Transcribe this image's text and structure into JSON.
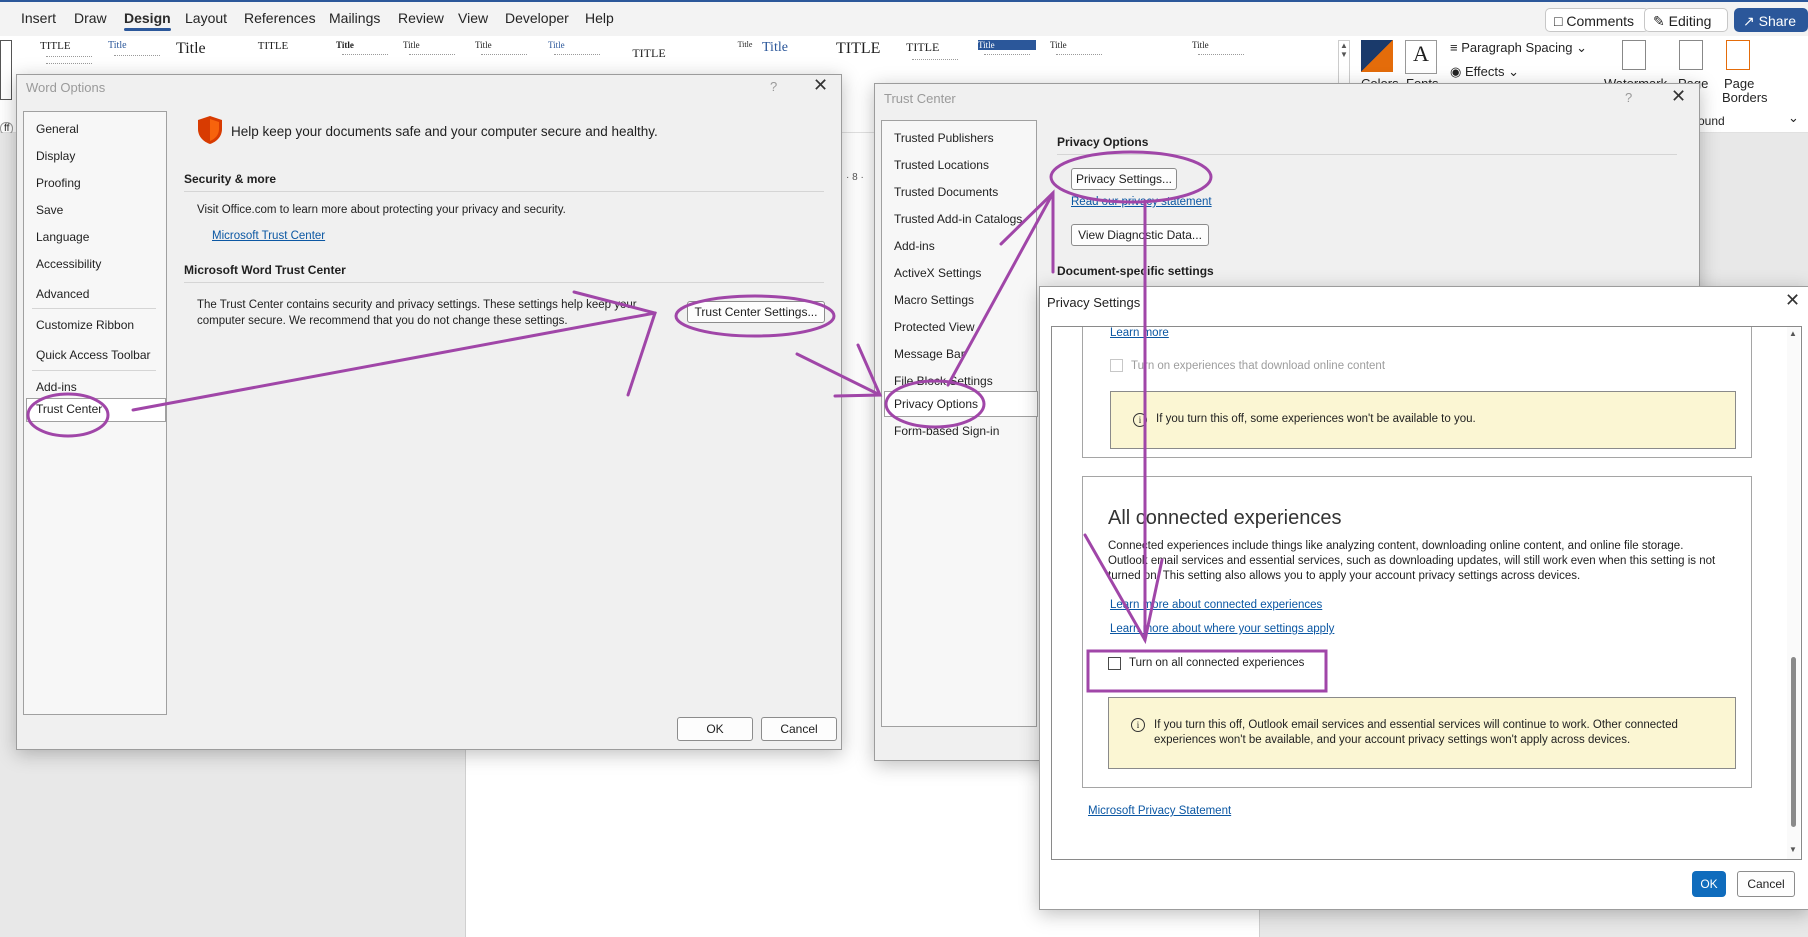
{
  "ribbon": {
    "tabs": [
      "Insert",
      "Draw",
      "Design",
      "Layout",
      "References",
      "Mailings",
      "Review",
      "View",
      "Developer",
      "Help"
    ],
    "active_tab": "Design",
    "comments": "Comments",
    "editing": "Editing",
    "share": "Share",
    "paragraph_spacing": "Paragraph Spacing",
    "effects": "Effects",
    "colors": "Colors",
    "fonts": "Fonts",
    "watermark": "Watermark",
    "page_color": "Page",
    "page_borders_1": "Page",
    "page_borders_2": "Borders",
    "page_background": "ound",
    "style_titles": [
      "TITLE",
      "Title",
      "Title",
      "TITLE",
      "Title",
      "Title",
      "Title",
      "Title",
      "TITLE",
      "Title",
      "Title",
      "TITLE",
      "TITLE",
      "Title",
      "Title",
      "Title"
    ],
    "ruler_mark": "· 8 ·",
    "left_fragment": "ff"
  },
  "word_options": {
    "title": "Word Options",
    "help": "?",
    "nav": [
      "General",
      "Display",
      "Proofing",
      "Save",
      "Language",
      "Accessibility",
      "Advanced",
      "Customize Ribbon",
      "Quick Access Toolbar",
      "Add-ins",
      "Trust Center"
    ],
    "selected": "Trust Center",
    "header": "Help keep your documents safe and your computer secure and healthy.",
    "security_heading": "Security & more",
    "security_text": "Visit Office.com to learn more about protecting your privacy and security.",
    "trust_link": "Microsoft Trust Center",
    "trust_heading": "Microsoft Word Trust Center",
    "trust_text_1": "The Trust Center contains security and privacy settings. These settings help keep your",
    "trust_text_2": "computer secure. We recommend that you do not change these settings.",
    "trust_button": "Trust Center Settings...",
    "ok": "OK",
    "cancel": "Cancel"
  },
  "trust_center": {
    "title": "Trust Center",
    "help": "?",
    "nav": [
      "Trusted Publishers",
      "Trusted Locations",
      "Trusted Documents",
      "Trusted Add-in Catalogs",
      "Add-ins",
      "ActiveX Settings",
      "Macro Settings",
      "Protected View",
      "Message Bar",
      "File Block Settings",
      "Privacy Options",
      "Form-based Sign-in"
    ],
    "selected": "Privacy Options",
    "privacy_heading": "Privacy Options",
    "privacy_button": "Privacy Settings...",
    "privacy_link": "Read our privacy statement",
    "diag_button": "View Diagnostic Data...",
    "doc_heading": "Document-specific settings"
  },
  "privacy_settings": {
    "title": "Privacy Settings",
    "learn_more": "Learn more",
    "download_label": "Turn on experiences that download online content",
    "info1": "If you turn this off, some experiences won't be available to you.",
    "section_title": "All connected experiences",
    "desc_1": "Connected experiences include things like analyzing content, downloading online content, and online file storage.",
    "desc_2": "Outlook email services and essential services, such as downloading updates, will still work even when this setting is not",
    "desc_3": "turned on. This setting also allows you to apply your account privacy settings across devices.",
    "link_1": "Learn more about connected experiences",
    "link_2": "Learn more about where your settings apply",
    "checkbox_label": "Turn on all connected experiences",
    "checked": false,
    "info2_1": "If you turn this off, Outlook email services and essential services will continue to work. Other connected",
    "info2_2": "experiences won't be available, and your account privacy settings won't apply across devices.",
    "statement_link": "Microsoft Privacy Statement",
    "ok": "OK",
    "cancel": "Cancel"
  },
  "colors": {
    "annotation": "#a046a8",
    "accent": "#2b579a",
    "primary_button": "#0f6cbd",
    "info_bg": "#fbf6d3"
  }
}
